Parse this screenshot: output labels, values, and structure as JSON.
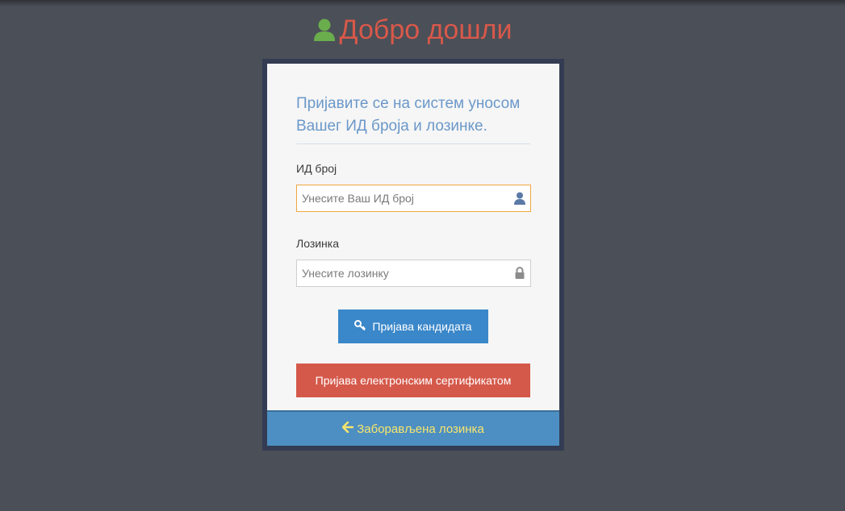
{
  "header": {
    "title": "Добро дошли",
    "icon": "user-icon",
    "title_color": "#d9584a",
    "icon_color": "#6aad4d"
  },
  "form": {
    "intro": "Пријавите се на систем уносом Вашег ИД броја и лозинке.",
    "id_label": "ИД број",
    "id_placeholder": "Унесите Ваш ИД број",
    "id_value": "",
    "id_icon": "user-icon",
    "password_label": "Лозинка",
    "password_placeholder": "Унесите лозинку",
    "password_value": "",
    "password_icon": "lock-icon",
    "login_button": "Пријава кандидата",
    "login_icon": "key-icon",
    "cert_button": "Пријава електронским сертификатом"
  },
  "footer": {
    "forgot_label": "Заборављена лозинка",
    "forgot_icon": "arrow-left-icon"
  },
  "colors": {
    "background": "#4b4f57",
    "primary": "#3a87c9",
    "danger": "#d5594a",
    "footer_text": "#f7e56d"
  }
}
